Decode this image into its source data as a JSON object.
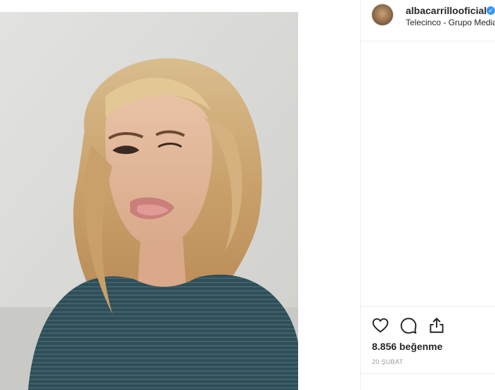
{
  "post": {
    "username": "albacarrillooficial",
    "verified_mark": "✓",
    "location": "Telecinco - Grupo Media",
    "likes": "8.856 beğenme",
    "date": "20 ŞUBAT"
  },
  "icons": {
    "like": "heart-icon",
    "comment": "comment-icon",
    "share": "share-icon",
    "verified": "verified-badge-icon"
  },
  "colors": {
    "text": "#262626",
    "muted": "#999999",
    "divider": "#efefef",
    "verified": "#3897f0"
  }
}
